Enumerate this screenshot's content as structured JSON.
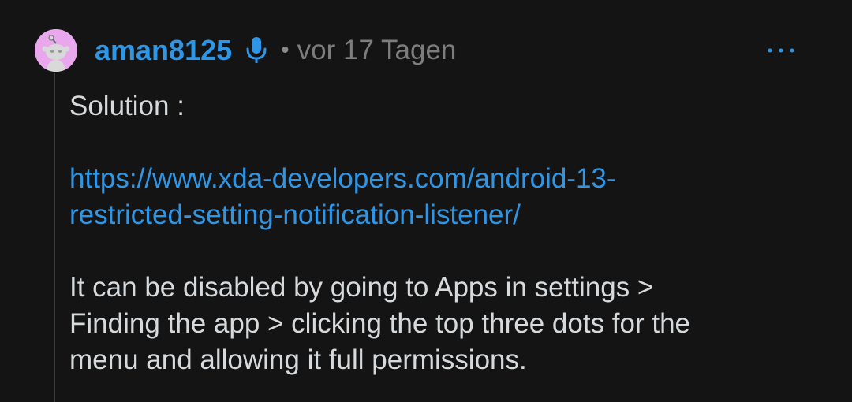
{
  "comment": {
    "username": "aman8125",
    "separator": "•",
    "time": "vor 17 Tagen",
    "more_label": "···",
    "paragraphs": {
      "solution": "Solution :",
      "link_line1": "https://www.xda-developers.com/android-13-",
      "link_line2": "restricted-setting-notification-listener/",
      "instructions_line1": "It can be disabled by going to Apps in settings >",
      "instructions_line2": "Finding the app > clicking the top three dots for the",
      "instructions_line3": "menu and allowing it full permissions."
    }
  },
  "icons": {
    "avatar": "snoo-avatar-icon",
    "mic": "microphone-icon",
    "more": "more-options-icon"
  },
  "colors": {
    "background": "#141414",
    "accent": "#2f96e6",
    "text": "#d7dadc",
    "muted": "#7d7d7d",
    "avatar_bg": "#e9a8ee"
  }
}
